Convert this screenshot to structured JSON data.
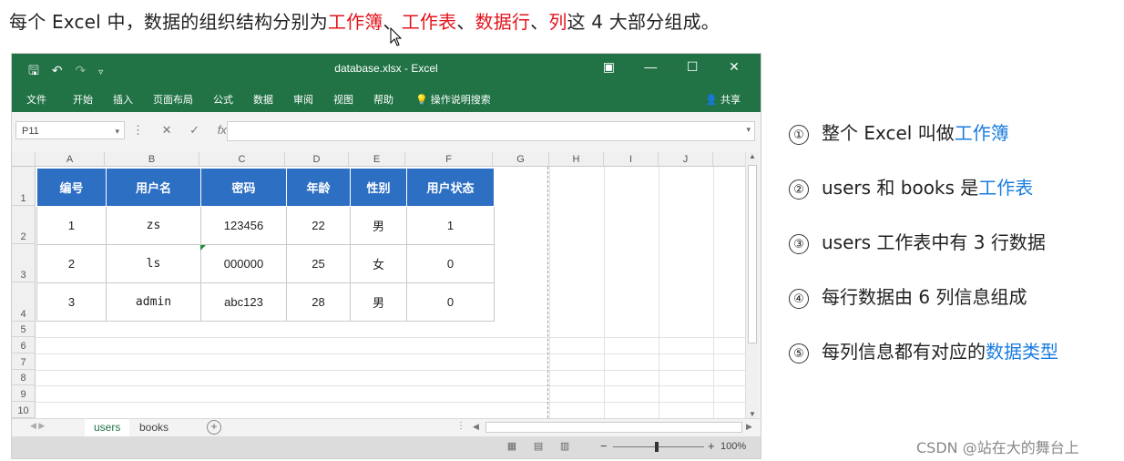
{
  "headline": {
    "part1": "每个 Excel 中，数据的组织结构分别为",
    "workbook": "工作簿",
    "sep1": "、",
    "worksheet": "工作表",
    "sep2": "、",
    "row": "数据行",
    "sep3": "、",
    "col": "列",
    "tail": "这 4 大部分组成。"
  },
  "excel": {
    "title": "database.xlsx - Excel",
    "ribbon_tabs": [
      "文件",
      "开始",
      "插入",
      "页面布局",
      "公式",
      "数据",
      "审阅",
      "视图",
      "帮助",
      "操作说明搜索"
    ],
    "share_label": "共享",
    "name_box": "P11",
    "columns": [
      "A",
      "B",
      "C",
      "D",
      "E",
      "F",
      "G",
      "H",
      "I",
      "J"
    ],
    "rows": [
      "1",
      "2",
      "3",
      "4",
      "5",
      "6",
      "7",
      "8",
      "9",
      "10"
    ],
    "table": {
      "headers": [
        "编号",
        "用户名",
        "密码",
        "年龄",
        "性别",
        "用户状态"
      ],
      "data": [
        [
          "1",
          "zs",
          "123456",
          "22",
          "男",
          "1"
        ],
        [
          "2",
          "ls",
          "000000",
          "25",
          "女",
          "0"
        ],
        [
          "3",
          "admin",
          "abc123",
          "28",
          "男",
          "0"
        ]
      ]
    },
    "sheets": [
      "users",
      "books"
    ],
    "active_sheet": "users",
    "zoom": "100%"
  },
  "notes": [
    {
      "num": "①",
      "text": "整个 Excel 叫做",
      "highlight": "工作簿"
    },
    {
      "num": "②",
      "text": "users 和 books 是",
      "highlight": "工作表"
    },
    {
      "num": "③",
      "text": "users 工作表中有 3 行数据",
      "highlight": ""
    },
    {
      "num": "④",
      "text": "每行数据由 6 列信息组成",
      "highlight": ""
    },
    {
      "num": "⑤",
      "text": "每列信息都有对应的",
      "highlight": "数据类型"
    }
  ],
  "watermark": "CSDN @站在大的舞台上",
  "colors": {
    "excel_green": "#217346",
    "header_blue": "#2d6fc2",
    "red": "#e3131d",
    "blue": "#1a7de0"
  }
}
